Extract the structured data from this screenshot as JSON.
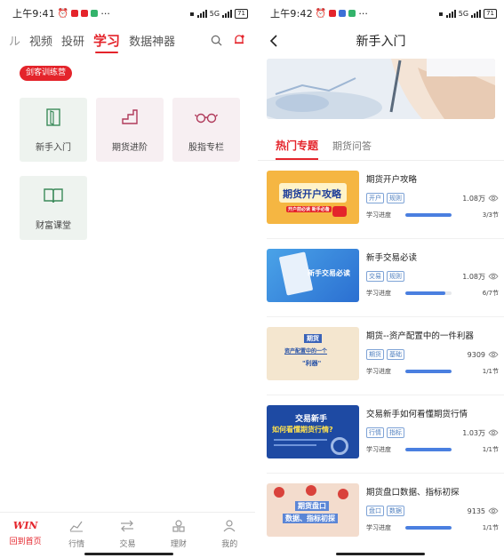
{
  "left": {
    "status": {
      "time": "上午9:41",
      "battery": "71",
      "net": "5G"
    },
    "nav": {
      "cut": "ル",
      "tabs": [
        "视频",
        "投研",
        "学习",
        "数据神器"
      ]
    },
    "camp_badge": "剑客训练营",
    "tiles": [
      "新手入门",
      "期货进阶",
      "股指专栏",
      "财富课堂"
    ],
    "bottom_nav": {
      "logo": "WIN",
      "items": [
        "回到首页",
        "行情",
        "交易",
        "理财",
        "我的"
      ]
    }
  },
  "right": {
    "status": {
      "time": "上午9:42",
      "battery": "71",
      "net": "5G"
    },
    "title": "新手入门",
    "tabs": [
      "热门专题",
      "期货问答"
    ],
    "progress_label": "学习进度",
    "courses": [
      {
        "title": "期货开户攻略",
        "tags": [
          "开户",
          "规则"
        ],
        "views": "1.08万",
        "progress": "3/3节",
        "ratio": 1.0,
        "thumb_text": "期货开户攻略",
        "thumb_sub": "开户前必读 新手必备"
      },
      {
        "title": "新手交易必读",
        "tags": [
          "交易",
          "规则"
        ],
        "views": "1.08万",
        "progress": "6/7节",
        "ratio": 0.86,
        "thumb_text": "新手交易必读"
      },
      {
        "title": "期货--资产配置中的一件利器",
        "tags": [
          "期货",
          "基础"
        ],
        "views": "9309",
        "progress": "1/1节",
        "ratio": 1.0,
        "thumb_text": "期货",
        "thumb_sub": "资产配置中的一个",
        "thumb_sub2": "\"利器\""
      },
      {
        "title": "交易新手如何看懂期货行情",
        "tags": [
          "行情",
          "指标"
        ],
        "views": "1.03万",
        "progress": "1/1节",
        "ratio": 1.0,
        "thumb_text": "交易新手",
        "thumb_sub": "如何看懂期货行情?"
      },
      {
        "title": "期货盘口数据、指标初探",
        "tags": [
          "盘口",
          "数据"
        ],
        "views": "9135",
        "progress": "1/1节",
        "ratio": 1.0,
        "thumb_text": "期货盘口",
        "thumb_sub": "数据、指标初探"
      }
    ]
  },
  "colors": {
    "accent": "#e4242b",
    "progress": "#4a7fe0",
    "tag": "#4f7fbf"
  }
}
